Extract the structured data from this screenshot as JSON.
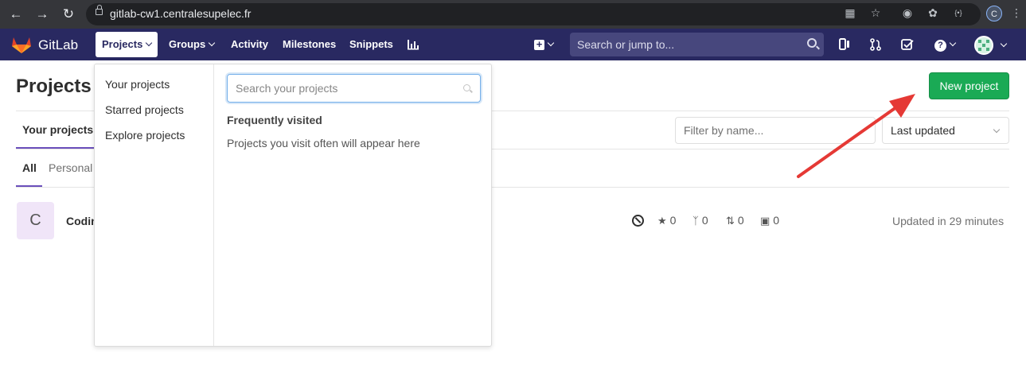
{
  "browser": {
    "url": "gitlab-cw1.centralesupelec.fr",
    "profile_initial": "C",
    "icons": [
      "back-icon",
      "forward-icon",
      "reload-icon",
      "lock-icon",
      "translate-icon",
      "star-icon",
      "extension-icon",
      "menu-icon"
    ]
  },
  "header": {
    "brand": "GitLab",
    "nav": {
      "projects": "Projects",
      "groups": "Groups",
      "activity": "Activity",
      "milestones": "Milestones",
      "snippets": "Snippets"
    },
    "search_placeholder": "Search or jump to...",
    "colors": {
      "background": "#292961",
      "search": "#47477d"
    }
  },
  "page": {
    "title": "Projects",
    "new_project_button": "New project",
    "tabs": {
      "your_projects": "Your projects"
    },
    "filter_placeholder": "Filter by name...",
    "sort_selected": "Last updated",
    "subtabs": {
      "all": "All",
      "personal": "Personal"
    },
    "project": {
      "avatar_letter": "C",
      "name_visible": "Codin",
      "stars": "0",
      "forks": "0",
      "merge_requests": "0",
      "issues": "0",
      "updated": "Updated in 29 minutes"
    },
    "colors": {
      "primary_button": "#1aaa55",
      "tab_underline": "#6b4fbb"
    }
  },
  "dropdown": {
    "links": [
      "Your projects",
      "Starred projects",
      "Explore projects"
    ],
    "search_placeholder": "Search your projects",
    "frequent_heading": "Frequently visited",
    "frequent_empty": "Projects you visit often will appear here"
  }
}
